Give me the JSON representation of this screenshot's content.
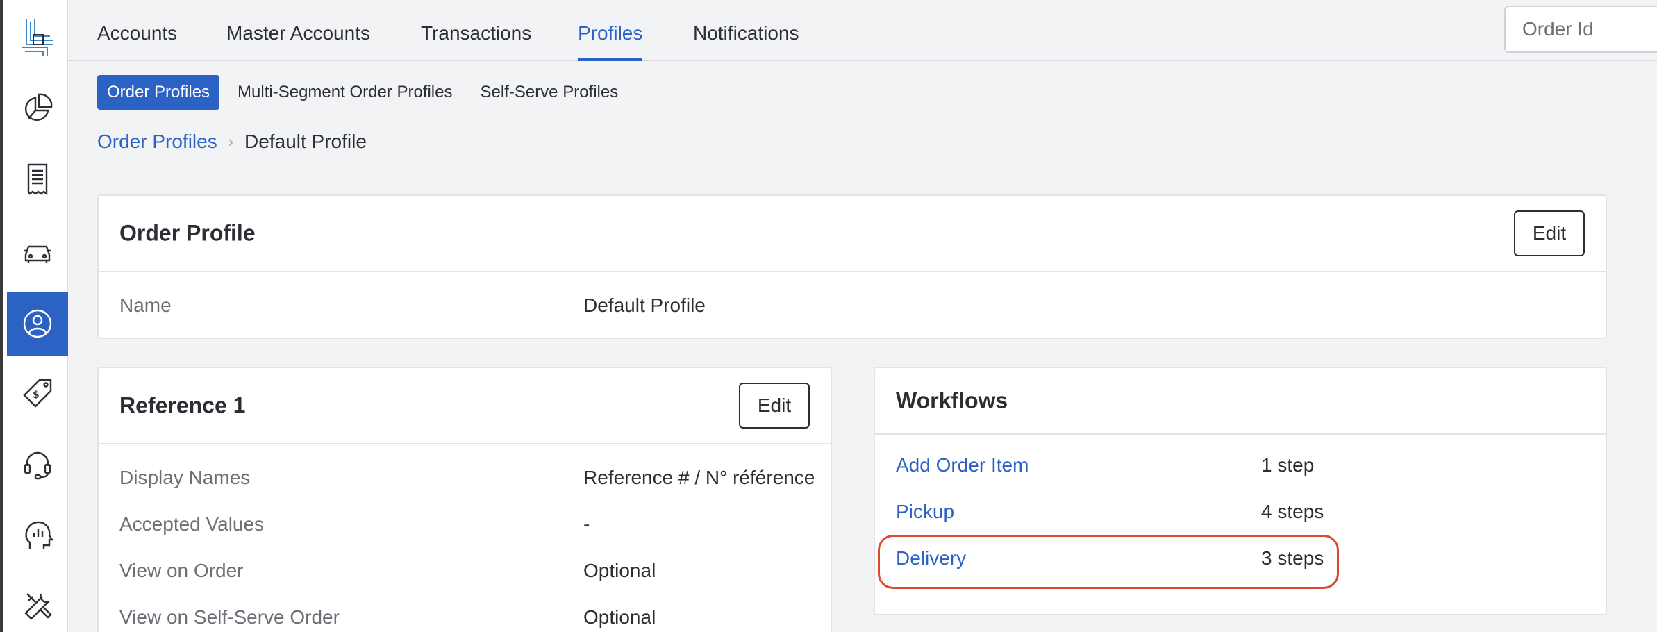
{
  "sidebar": {
    "items": [
      {
        "icon": "pie-chart-icon"
      },
      {
        "icon": "receipt-icon"
      },
      {
        "icon": "car-icon"
      },
      {
        "icon": "user-circle-icon",
        "active": true
      },
      {
        "icon": "price-tag-icon"
      },
      {
        "icon": "headset-icon"
      },
      {
        "icon": "head-analytics-icon"
      },
      {
        "icon": "tools-icon"
      }
    ]
  },
  "topnav": {
    "tabs": [
      {
        "label": "Accounts"
      },
      {
        "label": "Master Accounts"
      },
      {
        "label": "Transactions"
      },
      {
        "label": "Profiles",
        "active": true
      },
      {
        "label": "Notifications"
      }
    ],
    "search_placeholder": "Order Id"
  },
  "subtabs": [
    {
      "label": "Order Profiles",
      "active": true
    },
    {
      "label": "Multi-Segment Order Profiles"
    },
    {
      "label": "Self-Serve Profiles"
    }
  ],
  "breadcrumb": {
    "parent": "Order Profiles",
    "current": "Default Profile"
  },
  "order_profile": {
    "title": "Order Profile",
    "edit_label": "Edit",
    "name_label": "Name",
    "name_value": "Default Profile"
  },
  "reference": {
    "title": "Reference 1",
    "edit_label": "Edit",
    "rows": [
      {
        "label": "Display Names",
        "value": "Reference # / N° référence"
      },
      {
        "label": "Accepted Values",
        "value": "-"
      },
      {
        "label": "View on Order",
        "value": "Optional"
      },
      {
        "label": "View on Self-Serve Order",
        "value": "Optional"
      }
    ]
  },
  "workflows": {
    "title": "Workflows",
    "items": [
      {
        "name": "Add Order Item",
        "steps": "1 step"
      },
      {
        "name": "Pickup",
        "steps": "4 steps"
      },
      {
        "name": "Delivery",
        "steps": "3 steps"
      }
    ]
  },
  "colors": {
    "accent": "#2c62c4",
    "highlight": "#e0472b"
  }
}
